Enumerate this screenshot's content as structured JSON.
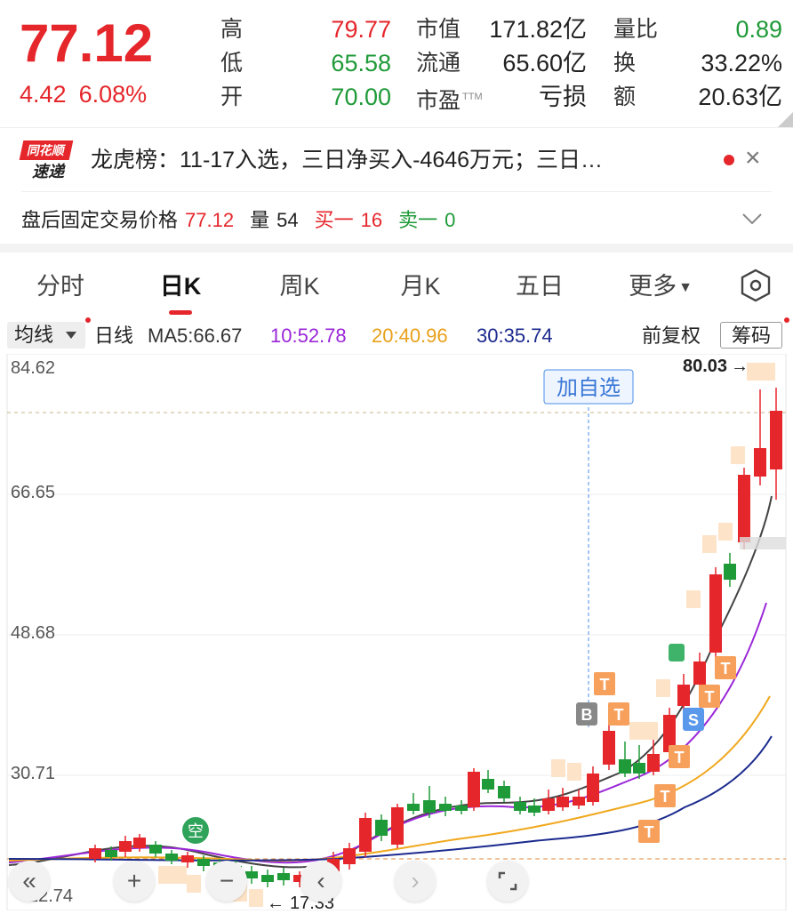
{
  "quote": {
    "price": "77.12",
    "change": "4.42",
    "change_pct": "6.08%",
    "high_label": "高",
    "high": "79.77",
    "low_label": "低",
    "low": "65.58",
    "open_label": "开",
    "open": "70.00",
    "mktcap_label": "市值",
    "mktcap": "171.82亿",
    "float_label": "流通",
    "float": "65.60亿",
    "pe_label": "市盈",
    "pe_suffix": "TTM",
    "pe": "亏损",
    "vol_ratio_label": "量比",
    "vol_ratio": "0.89",
    "turnover_label": "换",
    "turnover": "33.22%",
    "amount_label": "额",
    "amount": "20.63亿"
  },
  "news": {
    "logo_top": "同花顺",
    "logo_bottom": "速递",
    "text": "龙虎榜：11-17入选，三日净买入-4646万元；三日…",
    "close_icon": "close-icon"
  },
  "after_hours": {
    "label": "盘后固定交易价格",
    "price": "77.12",
    "vol_label": "量",
    "vol": "54",
    "buy_label": "买一",
    "buy": "16",
    "sell_label": "卖一",
    "sell": "0"
  },
  "tabs": [
    {
      "label": "分时"
    },
    {
      "label": "日K",
      "active": true
    },
    {
      "label": "周K"
    },
    {
      "label": "月K"
    },
    {
      "label": "五日"
    },
    {
      "label": "更多"
    }
  ],
  "ma": {
    "select_label": "均线",
    "period_label": "日线",
    "ma5": "MA5:66.67",
    "ma10": "10:52.78",
    "ma20": "20:40.96",
    "ma30": "30:35.74",
    "fq_label": "前复权",
    "chip_label": "筹码"
  },
  "colors": {
    "up": "#e5262b",
    "down": "#1f9a38",
    "ma5": "#444444",
    "ma10": "#9a27d8",
    "ma20": "#f0a81e",
    "ma30": "#1b2a8e",
    "marker_orange": "#f6a05c",
    "marker_blue": "#4b8fe8"
  },
  "chart": {
    "y_labels": [
      "84.62",
      "66.65",
      "48.68",
      "30.71",
      "12.74"
    ],
    "high_annot": "80.03",
    "low_annot": "17.33",
    "add_watch": "加自选",
    "kong": "空",
    "marker_b": "B",
    "marker_s": "S",
    "marker_t": "T"
  },
  "controls": {
    "back": "double-chevron-left-icon",
    "zoom_in": "plus-icon",
    "zoom_out": "minus-icon",
    "prev": "chevron-left-icon",
    "next": "chevron-right-icon",
    "fullscreen": "fullscreen-icon"
  }
}
